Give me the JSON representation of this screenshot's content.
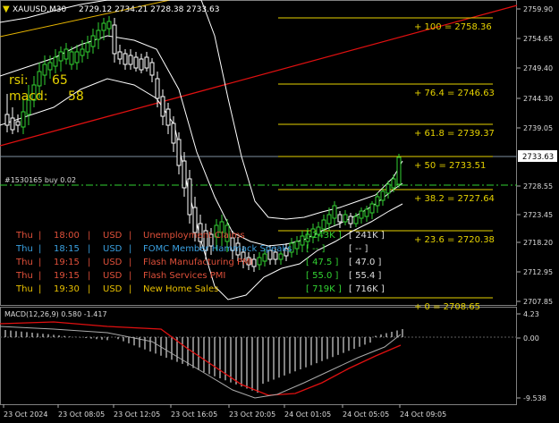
{
  "header": {
    "symbol": "XAUUSD,M30",
    "ohlc": "2729.12 2734.21 2728.38 2733.63"
  },
  "indicators": {
    "rsi_label": "rsi:",
    "rsi_value": "65",
    "macd_label": "macd:",
    "macd_value": "58"
  },
  "trade": {
    "label": "#1530165 buy 0.02"
  },
  "price_axis": {
    "ticks": [
      "2759.90",
      "2754.65",
      "2749.40",
      "2744.30",
      "2739.05",
      "2733.63",
      "2728.55",
      "2723.45",
      "2718.20",
      "2712.95",
      "2707.85"
    ],
    "current_price": "2733.63"
  },
  "fib_levels": [
    {
      "label": "+ 100  = 2758.36"
    },
    {
      "label": "+ 76.4  = 2746.63"
    },
    {
      "label": "+ 61.8  = 2739.37"
    },
    {
      "label": "+ 50   = 2733.51"
    },
    {
      "label": "+ 38.2  = 2727.64"
    },
    {
      "label": "+ 23.6  = 2720.38"
    },
    {
      "label": "+ 0  = 2708.65"
    }
  ],
  "news": [
    {
      "day": "Thu",
      "time": "18:00",
      "cur": "USD",
      "event": "Unemployment Claims",
      "actual": "[ 243K ]",
      "forecast": "[ 241K ]",
      "color": "#e0503a"
    },
    {
      "day": "Thu",
      "time": "18:15",
      "cur": "USD",
      "event": "FOMC Member Hammack Speaks",
      "actual": "[ -- ]",
      "forecast": "[ -- ]",
      "color": "#3aa0e0"
    },
    {
      "day": "Thu",
      "time": "19:15",
      "cur": "USD",
      "event": "Flash Manufacturing PMI",
      "actual": "[ 47.5 ]",
      "forecast": "[ 47.0 ]",
      "color": "#e0503a"
    },
    {
      "day": "Thu",
      "time": "19:15",
      "cur": "USD",
      "event": "Flash Services PMI",
      "actual": "[ 55.0 ]",
      "forecast": "[ 55.4 ]",
      "color": "#e0503a"
    },
    {
      "day": "Thu",
      "time": "19:30",
      "cur": "USD",
      "event": "New Home Sales",
      "actual": "[ 719K ]",
      "forecast": "[ 716K ]",
      "color": "#e8c000"
    }
  ],
  "macd": {
    "label": "MACD(12,26,9) 0.580 -1.417",
    "ticks": [
      "4.23",
      "0.00",
      "-9.538"
    ]
  },
  "time_axis": [
    "23 Oct 2024",
    "23 Oct 08:05",
    "23 Oct 12:05",
    "23 Oct 16:05",
    "23 Oct 20:05",
    "24 Oct 01:05",
    "24 Oct 05:05",
    "24 Oct 09:05"
  ],
  "colors": {
    "bull": "#32d232",
    "bear": "#ffffff",
    "fib": "#e6d200",
    "trend": "#e01010",
    "upper_trend": "#e6b400",
    "band": "#ffffff",
    "grid": "#303030",
    "signal": "#e01010"
  }
}
